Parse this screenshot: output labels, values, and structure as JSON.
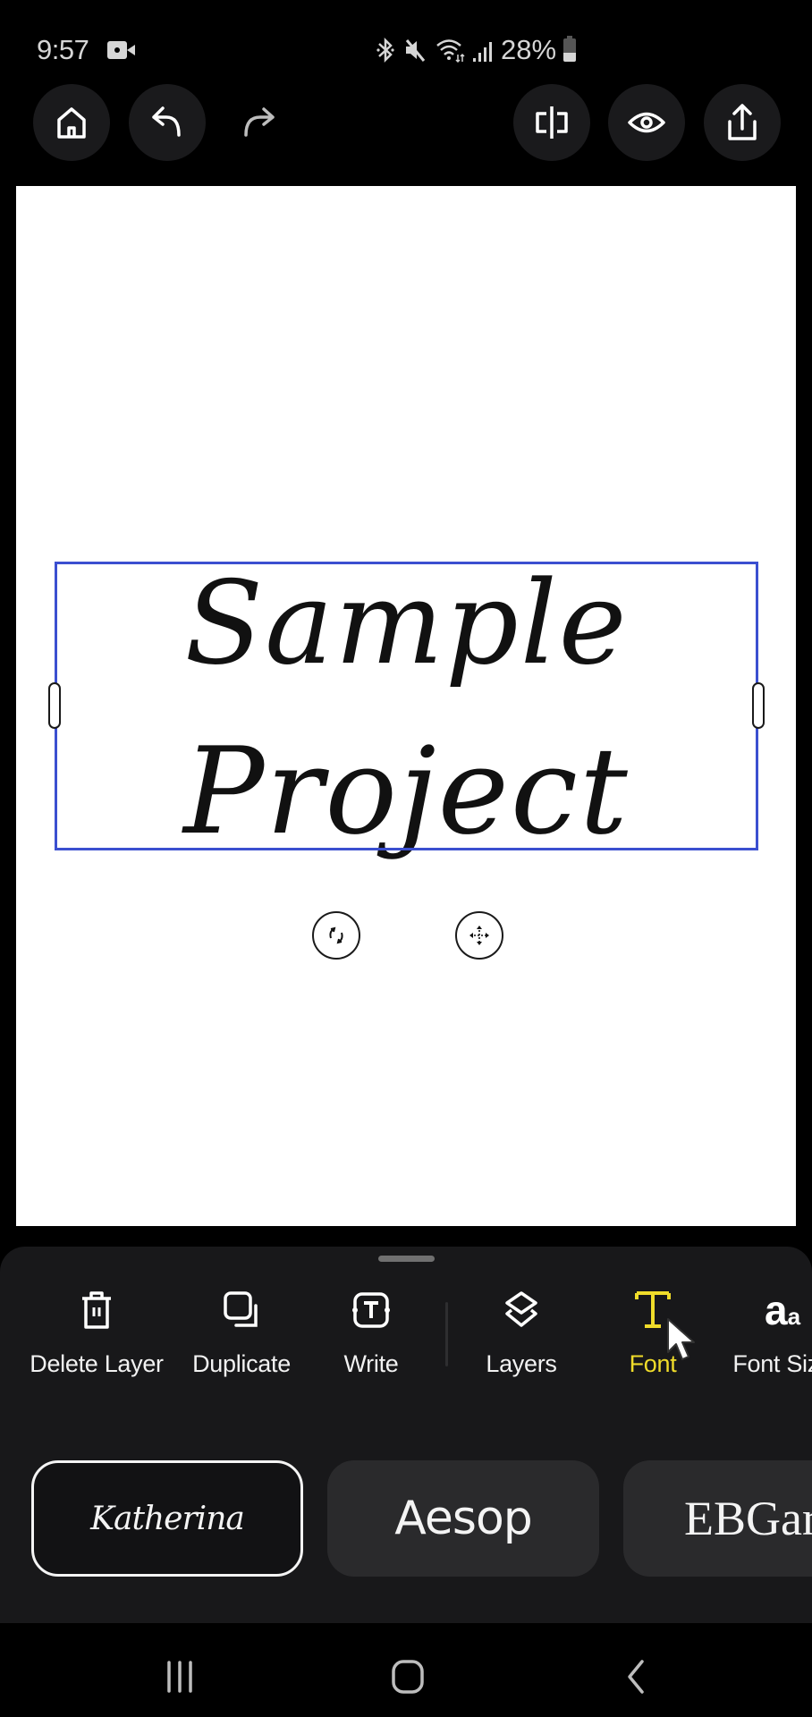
{
  "status_bar": {
    "time": "9:57",
    "battery": "28%",
    "icons": [
      "video-camera-icon",
      "bluetooth-icon",
      "mute-icon",
      "wifi-icon",
      "signal-icon",
      "battery-icon"
    ]
  },
  "top_toolbar": {
    "left": [
      {
        "name": "home",
        "icon": "home-icon"
      },
      {
        "name": "undo",
        "icon": "undo-icon"
      },
      {
        "name": "redo",
        "icon": "redo-icon"
      }
    ],
    "right": [
      {
        "name": "flip",
        "icon": "flip-horizontal-icon"
      },
      {
        "name": "preview",
        "icon": "eye-icon"
      },
      {
        "name": "export",
        "icon": "share-icon"
      }
    ]
  },
  "canvas": {
    "text_layer": {
      "lines": [
        "Sample",
        "Project"
      ],
      "font": "Katherina",
      "color": "#111111"
    },
    "selection_color": "#3b4fd0",
    "controls": [
      {
        "name": "rotate",
        "icon": "rotate-icon"
      },
      {
        "name": "move",
        "icon": "move-icon"
      }
    ]
  },
  "bottom_toolbar": {
    "tools": [
      {
        "label": "Delete Layer",
        "icon": "trash-icon",
        "active": false
      },
      {
        "label": "Duplicate",
        "icon": "duplicate-icon",
        "active": false
      },
      {
        "label": "Write",
        "icon": "text-box-icon",
        "active": false
      },
      {
        "label": "Layers",
        "icon": "layers-icon",
        "active": false
      },
      {
        "label": "Font",
        "icon": "font-t-icon",
        "active": true
      },
      {
        "label": "Font Size",
        "icon": "font-size-icon",
        "active": false
      }
    ],
    "active_color": "#f0dc2a"
  },
  "fonts": {
    "selected": "Katherina",
    "items": [
      {
        "name": "Katherina",
        "selected": true
      },
      {
        "name": "Aesop",
        "selected": false
      },
      {
        "name": "EBGaramond",
        "selected": false
      }
    ]
  },
  "nav_bar": {
    "buttons": [
      {
        "name": "recents",
        "icon": "recents-icon"
      },
      {
        "name": "home",
        "icon": "home-circle-icon"
      },
      {
        "name": "back",
        "icon": "back-chevron-icon"
      }
    ]
  }
}
